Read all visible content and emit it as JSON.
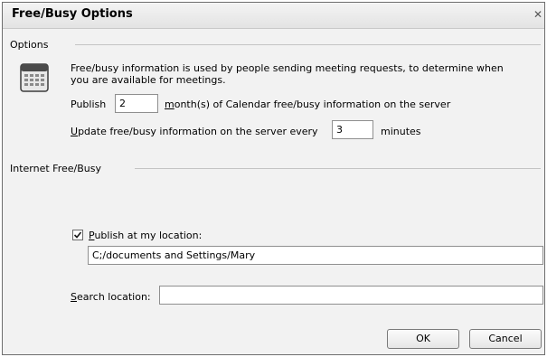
{
  "window": {
    "title": "Free/Busy Options",
    "close_glyph": "✕"
  },
  "options": {
    "group_label": "Options",
    "description": "Free/busy information is used by people sending meeting requests, to determine when you are available for meetings.",
    "publish_prefix": "Publish",
    "publish_months": "2",
    "publish_suffix_accel": "m",
    "publish_suffix_rest": "onth(s) of Calendar free/busy information on the server",
    "update_accel": "U",
    "update_rest": "pdate free/busy information on the server every",
    "update_minutes": "3",
    "minutes_label": "minutes"
  },
  "internet": {
    "group_label": "Internet Free/Busy",
    "publish_checked": true,
    "publish_accel": "P",
    "publish_rest": "ublish at my location:",
    "publish_location": "C;/documents and Settings/Mary",
    "search_accel": "S",
    "search_rest": "earch location:",
    "search_location": ""
  },
  "buttons": {
    "ok": "OK",
    "cancel": "Cancel"
  },
  "icons": {
    "calendar": "calendar-icon",
    "close": "close-icon",
    "check": "checkmark-icon"
  }
}
